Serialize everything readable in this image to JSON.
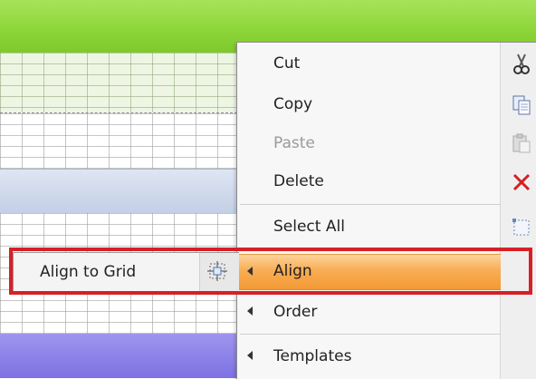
{
  "context_menu": {
    "items": [
      {
        "label": "Cut",
        "icon": "scissors-icon",
        "enabled": true
      },
      {
        "label": "Copy",
        "icon": "copy-icon",
        "enabled": true
      },
      {
        "label": "Paste",
        "icon": "paste-icon",
        "enabled": false
      },
      {
        "label": "Delete",
        "icon": "delete-x-icon",
        "enabled": true
      },
      {
        "label": "Select All",
        "icon": "select-all-icon",
        "enabled": true
      },
      {
        "label": "Align",
        "submenu": true,
        "highlighted": true
      },
      {
        "label": "Order",
        "submenu": true
      },
      {
        "label": "Templates",
        "submenu": true
      }
    ]
  },
  "align_submenu": {
    "items": [
      {
        "label": "Align to Grid",
        "icon": "align-grid-icon"
      }
    ]
  },
  "colors": {
    "highlight": "#f8ad55",
    "callout_border": "#d62027",
    "delete_icon": "#d42020",
    "header_band": "#8ed63a",
    "section_band_blue": "#c3cfe6",
    "section_band_purple": "#7d71e2"
  }
}
